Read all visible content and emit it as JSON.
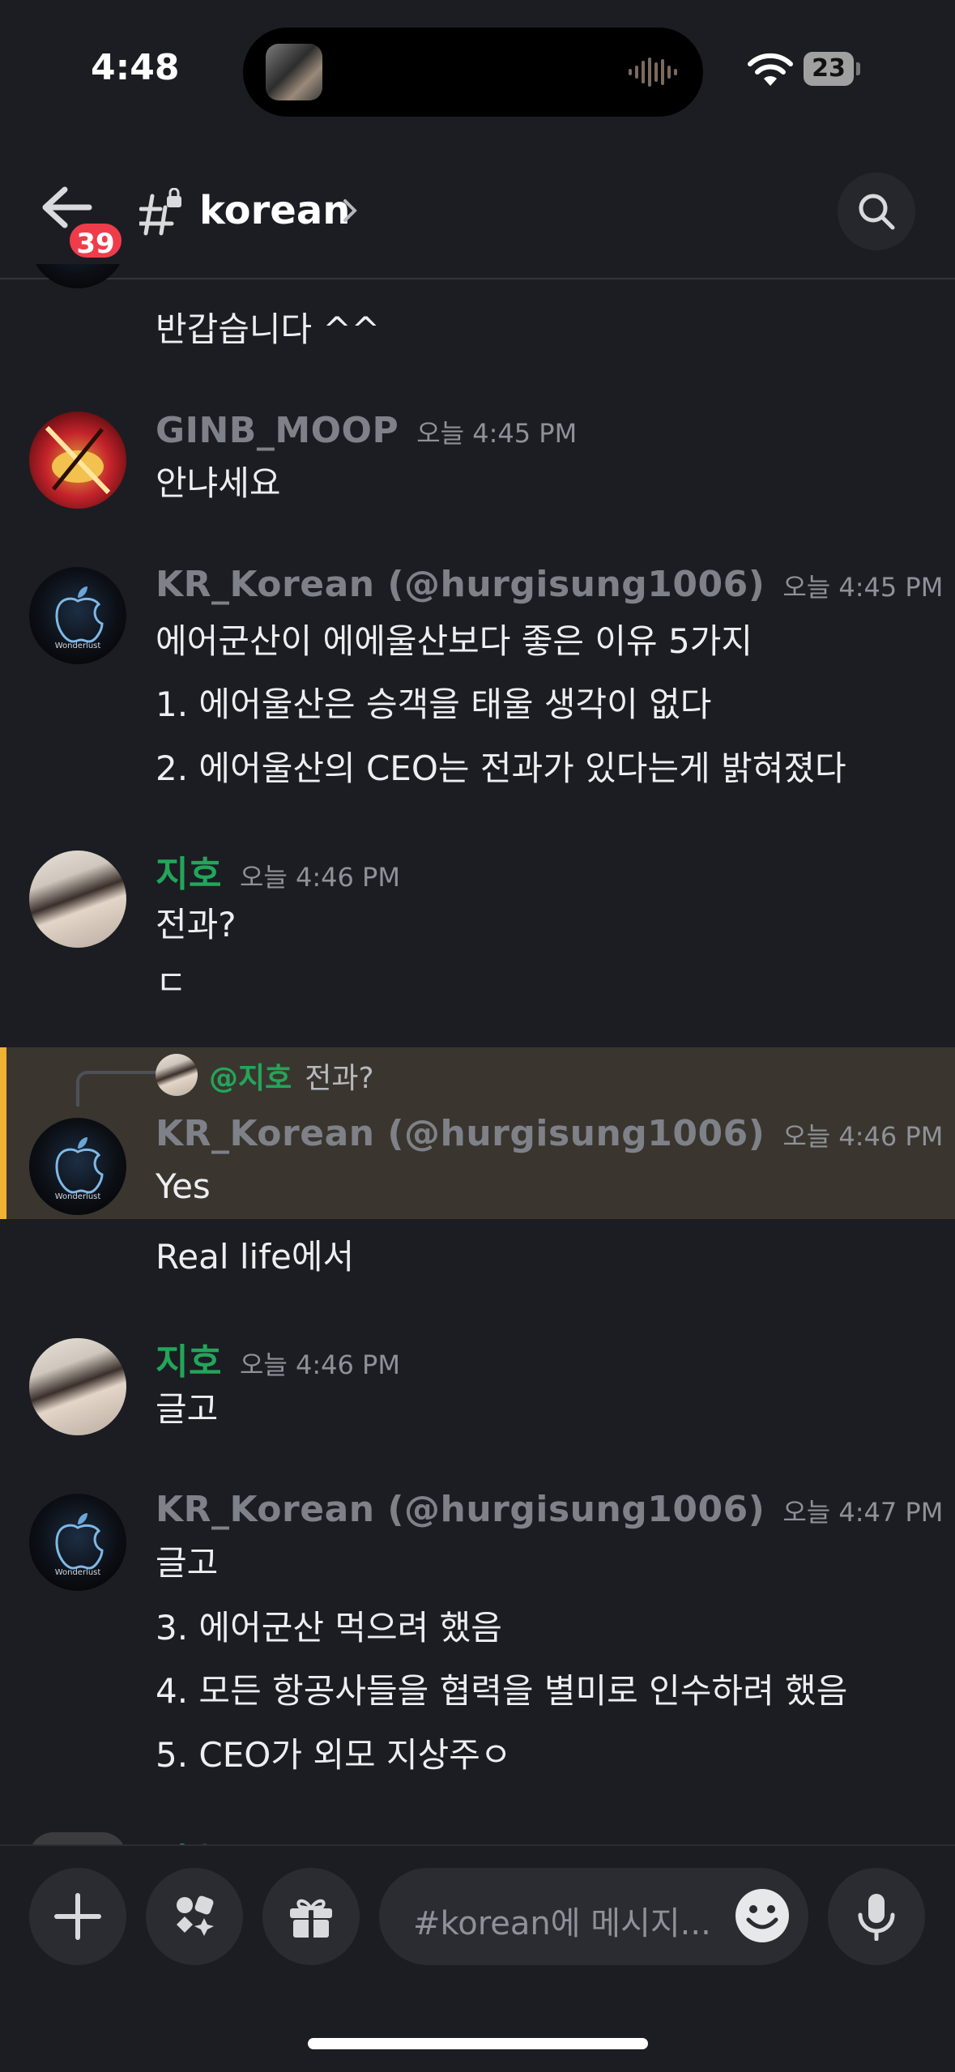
{
  "status_bar": {
    "time": "4:48",
    "battery": "23"
  },
  "header": {
    "unread_badge": "39",
    "channel_name": "korean"
  },
  "messages": [
    {
      "lines": [
        "반갑습니다 ^^"
      ]
    },
    {
      "author": "GINB_MOOP",
      "time": "오늘 4:45 PM",
      "lines": [
        "안냐세요"
      ]
    },
    {
      "author": "KR_Korean (@hurgisung1006)",
      "time": "오늘 4:45 PM",
      "lines": [
        "에어군산이 에에울산보다 좋은 이유 5가지",
        "1.  에어울산은 승객을 태울 생각이 없다",
        "2.  에어울산의 CEO는 전과가 있다는게 밝혀졌다"
      ]
    },
    {
      "author": "지호",
      "time": "오늘 4:46 PM",
      "lines": [
        "전과?",
        "ㄷ"
      ]
    },
    {
      "reply_to": {
        "mention": "@지호",
        "text": "전과?"
      },
      "author": "KR_Korean (@hurgisung1006)",
      "time": "오늘 4:46 PM",
      "lines": [
        "Yes",
        "Real life에서"
      ]
    },
    {
      "author": "지호",
      "time": "오늘 4:46 PM",
      "lines": [
        "글고"
      ]
    },
    {
      "author": "KR_Korean (@hurgisung1006)",
      "time": "오늘 4:47 PM",
      "lines": [
        "글고",
        "3.  에어군산 먹으려 했음",
        "4.  모든 항공사들을 협력을 별미로 인수하려 했음",
        "5.  CEO가 외모 지상주ㅇ"
      ]
    },
    {
      "author": "지호"
    }
  ],
  "avatar_caption": "Wonderlust",
  "composer": {
    "placeholder": "#korean에 메시지..."
  }
}
